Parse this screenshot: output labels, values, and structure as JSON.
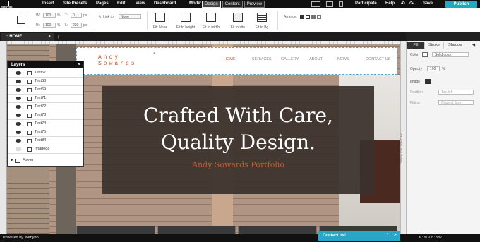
{
  "topbar": {
    "logo_text": "Webydo",
    "menu": [
      "Insert",
      "Site Presets",
      "Pages",
      "Edit",
      "View",
      "Dashboard"
    ],
    "mode_label": "Mode:",
    "modes": [
      "Design",
      "Content",
      "Preview"
    ],
    "active_mode": "Design",
    "participate": "Participate",
    "help": "Help",
    "save": "Save",
    "publish": "Publish"
  },
  "toolbar": {
    "w_label": "W:",
    "w_value": "100",
    "w_unit": "%",
    "t_label": "T:",
    "t_value": "0",
    "t_unit": "px",
    "h_label": "H:",
    "h_value": "100",
    "h_unit": "%",
    "l_label": "L:",
    "l_value": "230",
    "l_unit": "px",
    "link_label": "Link to",
    "link_value": "None",
    "fit_none": "Fit: None",
    "fit_height": "Fit to height",
    "fit_width": "Fit to width",
    "fit_site": "Fit to site",
    "fit_bg": "Fit to Bg",
    "arrange": "Arrange:"
  },
  "tabs": {
    "home": "HOME",
    "add": "+"
  },
  "site": {
    "brand_line1": "Andy",
    "brand_line2": "Sowards",
    "brand_dot": "*",
    "nav": [
      "HOME",
      "SERVICES",
      "GALLERY",
      "ABOUT",
      "NEWS",
      "CONTACT US"
    ],
    "hero_line1": "Crafted With Care,",
    "hero_line2": "Quality Design.",
    "hero_sub": "Andy Sowards Portfolio"
  },
  "layers": {
    "title": "Layers",
    "close": "×",
    "rows": [
      {
        "name": "Text67",
        "type": "text",
        "visible": true
      },
      {
        "name": "Text68",
        "type": "text",
        "visible": true
      },
      {
        "name": "Text69",
        "type": "text",
        "visible": true
      },
      {
        "name": "Text71",
        "type": "text",
        "visible": true
      },
      {
        "name": "Text72",
        "type": "text",
        "visible": true
      },
      {
        "name": "Text73",
        "type": "text",
        "visible": true
      },
      {
        "name": "Text74",
        "type": "text",
        "visible": true
      },
      {
        "name": "Text75",
        "type": "text",
        "visible": true
      },
      {
        "name": "Text84",
        "type": "text",
        "visible": true
      },
      {
        "name": "Image88",
        "type": "image",
        "visible": false
      }
    ],
    "footer": "Footer"
  },
  "props": {
    "tabs": [
      "Fill",
      "Stroke",
      "Shadow"
    ],
    "active_tab": "Fill",
    "color_label": "Color",
    "color_value": "Solid color",
    "opacity_label": "Opacity",
    "opacity_value": "100",
    "opacity_unit": "%",
    "image_label": "Image",
    "position_label": "Position",
    "position_value": "Top-left",
    "fitting_label": "Fitting",
    "fitting_value": "Original Size",
    "rail_label": "PROPERTIES PANEL"
  },
  "bottom": {
    "powered": "Powered by Webydo",
    "contact": "Contact us!",
    "coords": "X : 819 Y : 582"
  },
  "colors": {
    "accent": "#d2562b",
    "publish": "#1fa9c4",
    "contact": "#2aa7c8"
  }
}
